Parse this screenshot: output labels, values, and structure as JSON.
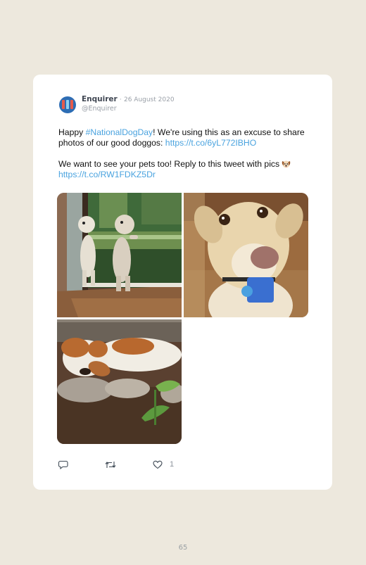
{
  "tweet": {
    "author_name": "Enquirer",
    "separator": "·",
    "date": "26 August 2020",
    "handle": "@Enquirer",
    "text_1a": "Happy ",
    "hashtag": "#NationalDogDay",
    "text_1b": "! We're using this as an excuse to share photos of our good doggos: ",
    "link_1": "https://t.co/6yL772IBHO",
    "text_2": "We want to see your pets too! Reply to this tweet with pics ",
    "link_2": "https://t.co/RW1FDKZ5Dr",
    "like_count": "1"
  },
  "icons": {
    "avatar": "enquirer-logo-icon",
    "emoji": "dog-face-icon",
    "reply": "reply-icon",
    "retweet": "retweet-icon",
    "like": "heart-icon"
  },
  "photos": [
    "dogs-at-window-photo",
    "dog-closeup-photo",
    "dog-lying-in-dirt-photo"
  ],
  "colors": {
    "page_background": "#ede8dd",
    "card_background": "#ffffff",
    "link": "#4aa3df",
    "name": "#3f4652",
    "muted": "#9aa0a8"
  },
  "page": {
    "number": "65"
  }
}
